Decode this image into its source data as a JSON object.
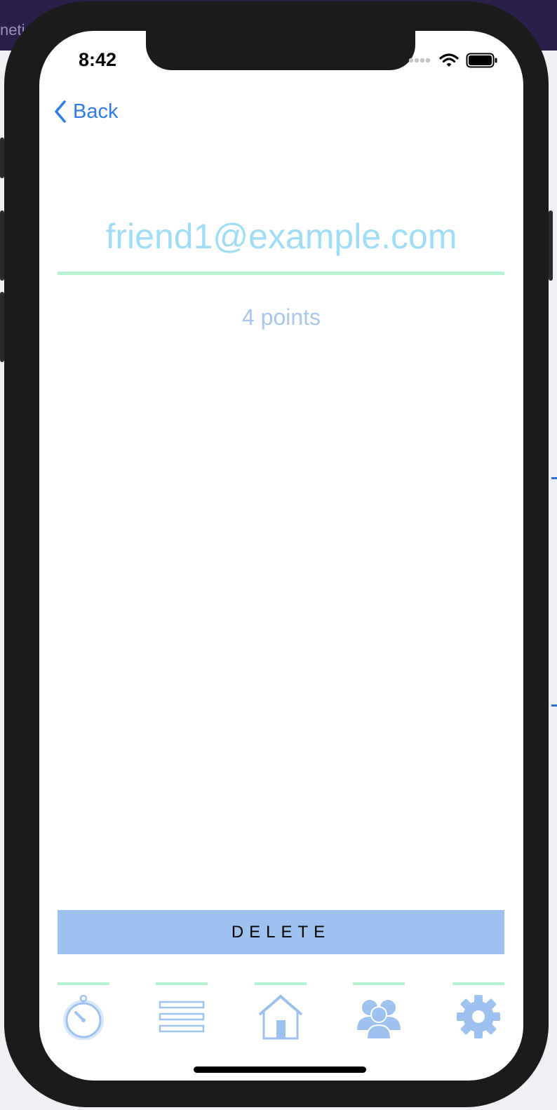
{
  "background": {
    "partial_text": "neti"
  },
  "status_bar": {
    "time": "8:42"
  },
  "nav": {
    "back_label": "Back"
  },
  "friend": {
    "email": "friend1@example.com",
    "points": "4 points"
  },
  "actions": {
    "delete_label": "DELETE"
  },
  "tab_bar": {
    "tabs": [
      {
        "icon": "stopwatch-icon"
      },
      {
        "icon": "list-icon"
      },
      {
        "icon": "home-icon"
      },
      {
        "icon": "friends-icon"
      },
      {
        "icon": "gear-icon"
      }
    ]
  },
  "colors": {
    "accent_blue": "#2f7be8",
    "email_text": "#9fdcf5",
    "underline_green": "#b6f3d3",
    "points_text": "#a9c6ec",
    "delete_bg": "#9ec2f0",
    "icon_blue": "#9ec2f0"
  }
}
